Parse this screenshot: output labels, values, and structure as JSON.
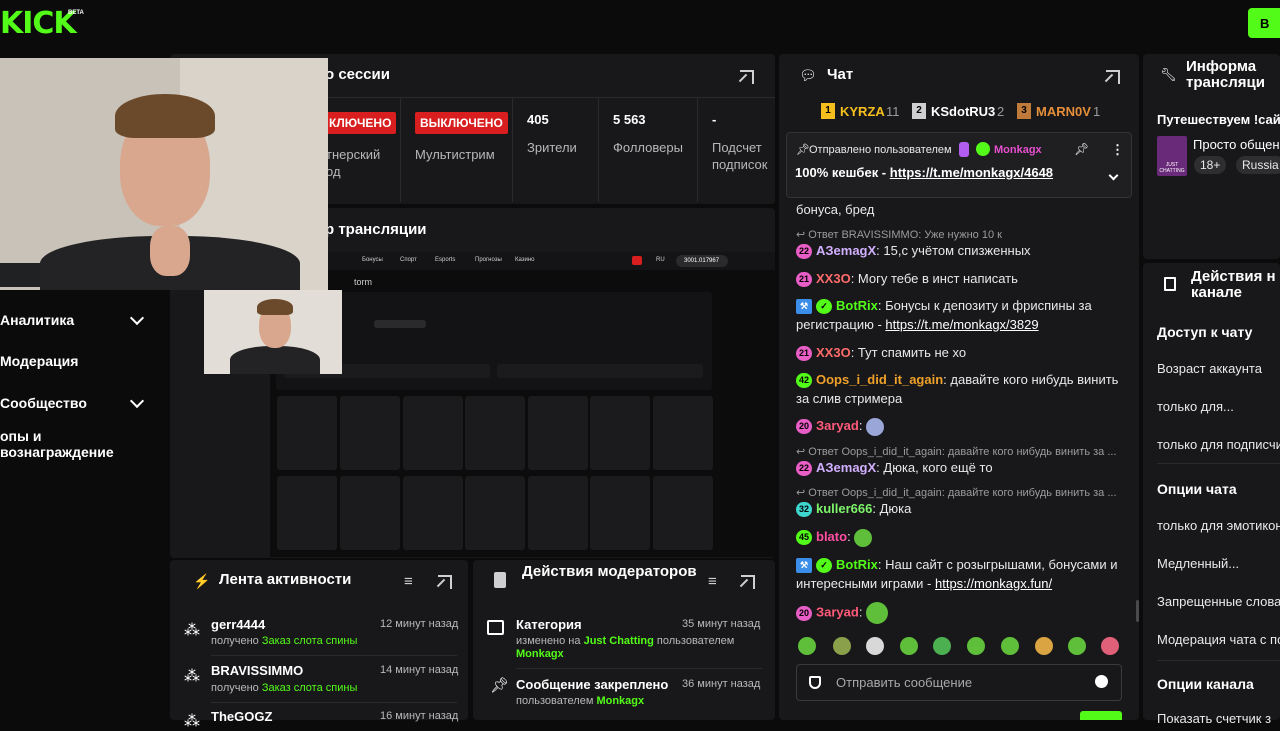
{
  "brand": {
    "logo": "KICK",
    "beta": "BETA",
    "top_button": "В"
  },
  "colors": {
    "accent": "#53fc18",
    "red": "#d81e1e",
    "panel": "#18181a",
    "bg": "#0b0b0c"
  },
  "sidebar": {
    "items": [
      {
        "label": "Аналитика",
        "expandable": true
      },
      {
        "label": "Модерация",
        "expandable": false
      },
      {
        "label": "Сообщество",
        "expandable": true
      },
      {
        "label": "опы и вознаграждение",
        "expandable": false
      }
    ]
  },
  "session": {
    "title": "о сессии",
    "stats": [
      {
        "badge": "КЛЮЧЕНО",
        "label": "тнерский\nод"
      },
      {
        "badge": "ВЫКЛЮЧЕНО",
        "label": "Мультистрим"
      },
      {
        "value": "405",
        "label": "Зрители"
      },
      {
        "value": "5 563",
        "label": "Фолловеры"
      },
      {
        "value": "-",
        "label": "Подсчет\nподписок"
      }
    ]
  },
  "preview": {
    "title": "р трансляции",
    "nav": [
      "Бонусы",
      "Спорт",
      "Esports",
      "Прогнозы",
      "Казино"
    ],
    "lang": "RU",
    "balance": "3001.017967",
    "subtitle": "torm"
  },
  "activity": {
    "title": "Лента активности",
    "rows": [
      {
        "name": "gerr4444",
        "prefix": "получено",
        "item": "Заказ слота спины",
        "time": "12 минут назад"
      },
      {
        "name": "BRAVISSIMMO",
        "prefix": "получено",
        "item": "Заказ слота спины",
        "time": "14 минут назад"
      },
      {
        "name": "TheGOGZ",
        "prefix": "",
        "item": "",
        "time": "16 минут назад"
      }
    ]
  },
  "modactions": {
    "title": "Действия модераторов",
    "rows": [
      {
        "name": "Категория",
        "pre": "изменено на",
        "hl1": "Just Chatting",
        "mid": "пользователем",
        "hl2": "Monkagx",
        "time": "35 минут назад"
      },
      {
        "name": "Сообщение закреплено",
        "pre": "пользователем",
        "hl1": "Monkagx",
        "time": "36 минут назад"
      }
    ]
  },
  "chat": {
    "title": "Чат",
    "leaders": [
      {
        "rank": "1",
        "name": "KYRZA",
        "count": "11"
      },
      {
        "rank": "2",
        "name": "KSdotRU3",
        "count": "2"
      },
      {
        "rank": "3",
        "name": "MARN0V",
        "count": "1"
      }
    ],
    "pinned": {
      "label": "Отправлено пользователем",
      "user": "Monkagx",
      "text": "100% кешбек - ",
      "link": "https://t.me/monkagx/4648"
    },
    "messages": [
      {
        "text": "бонуса, бред"
      },
      {
        "reply": "Ответ BRAVISSIMMO: Уже нужно 10 к"
      },
      {
        "badge": "22",
        "user": "АЗemagX",
        "text": ": 15,с учётом спизженных"
      },
      {
        "badge": "21",
        "user": "XX3O",
        "text": ": Могу тебе в инст написать"
      },
      {
        "user": "BotRix",
        "text": ": Бонусы к депозиту и фриспины за регистрацию - ",
        "link": "https://t.me/monkagx/3829"
      },
      {
        "badge": "21",
        "user": "XX3O",
        "text": ": Тут спамить не хо"
      },
      {
        "badge": "42",
        "user": "Oops_i_did_it_again",
        "text": ": давайте кого нибудь винить за слив стримера"
      },
      {
        "badge": "20",
        "user": "Зaryad",
        "text": ":"
      },
      {
        "reply": "Ответ Oops_i_did_it_again: давайте кого нибудь винить за ..."
      },
      {
        "badge": "22",
        "user": "АЗemagX",
        "text": ": Дюка, кого ещё то"
      },
      {
        "reply": "Ответ Oops_i_did_it_again: давайте кого нибудь винить за ..."
      },
      {
        "badge": "32",
        "user": "kuller666",
        "text": ": Дюка"
      },
      {
        "badge": "45",
        "user": "blato",
        "text": ":"
      },
      {
        "user": "BotRix",
        "text": ": Наш сайт с розыгрышами, бонусами и интересными играми - ",
        "link": "https://monkagx.fun/"
      },
      {
        "badge": "20",
        "user": "Зaryad",
        "text": ":"
      }
    ],
    "input_placeholder": "Отправить сообщение"
  },
  "info": {
    "title": "Информа\nтрансляци",
    "stream_title": "Путешествуем !сайт",
    "category": "Просто общен",
    "tags": [
      "18+",
      "Russia"
    ],
    "thumb_label": "JUST CHATTING"
  },
  "actions": {
    "title": "Действия н\nканале",
    "sections": [
      {
        "head": "Доступ к чату",
        "items": [
          "Возраст аккаунта",
          "только для...",
          "только для подписчи"
        ]
      },
      {
        "head": "Опции чата",
        "items": [
          "только для эмотикон",
          "Медленный...",
          "Запрещенные слова",
          "Модерация чата с по"
        ]
      },
      {
        "head": "Опции канала",
        "items": [
          "Показать счетчик з"
        ]
      }
    ]
  }
}
